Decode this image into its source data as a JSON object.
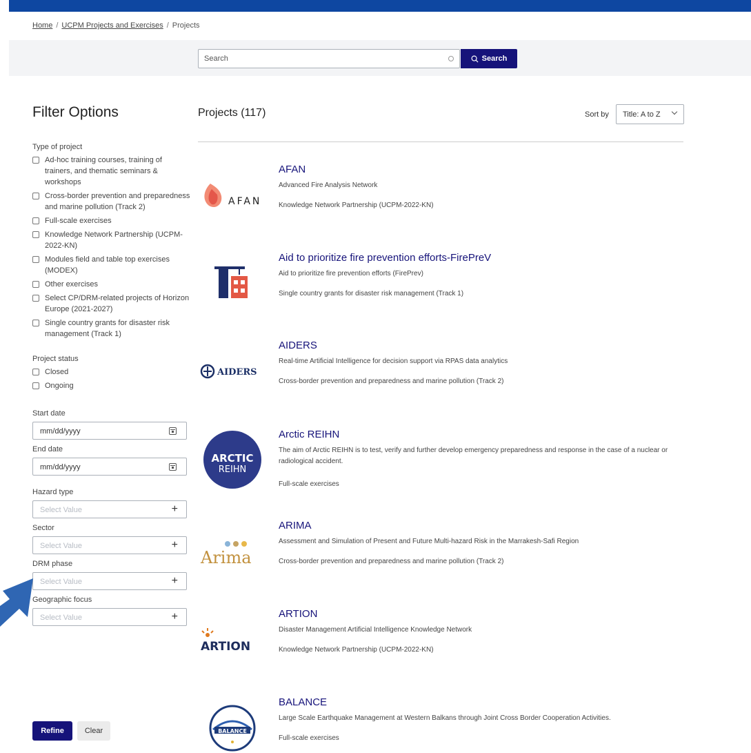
{
  "breadcrumb": {
    "home": "Home",
    "section": "UCPM Projects and Exercises",
    "current": "Projects",
    "separator": "/"
  },
  "search": {
    "placeholder": "Search",
    "button_label": "Search"
  },
  "filters": {
    "title": "Filter Options",
    "type_of_project": {
      "label": "Type of project",
      "options": [
        "Ad-hoc training courses, training of trainers, and thematic seminars & workshops",
        "Cross-border prevention and preparedness and marine pollution (Track 2)",
        "Full-scale exercises",
        "Knowledge Network Partnership (UCPM-2022-KN)",
        "Modules field and table top exercises (MODEX)",
        "Other exercises",
        "Select CP/DRM-related projects of Horizon Europe (2021-2027)",
        "Single country grants for disaster risk management (Track 1)"
      ]
    },
    "project_status": {
      "label": "Project status",
      "options": [
        "Closed",
        "Ongoing"
      ]
    },
    "start_date": {
      "label": "Start date",
      "value": "mm/dd/yyyy"
    },
    "end_date": {
      "label": "End date",
      "value": "mm/dd/yyyy"
    },
    "hazard_type": {
      "label": "Hazard type",
      "placeholder": "Select Value"
    },
    "sector": {
      "label": "Sector",
      "placeholder": "Select Value"
    },
    "drm_phase": {
      "label": "DRM phase",
      "placeholder": "Select Value"
    },
    "geographic_focus": {
      "label": "Geographic focus",
      "placeholder": "Select Value"
    },
    "refine_label": "Refine",
    "clear_label": "Clear"
  },
  "results": {
    "title": "Projects (117)",
    "sort_label": "Sort by",
    "sort_value": "Title: A to Z",
    "projects": [
      {
        "title": "AFAN",
        "description": "Advanced Fire Analysis Network",
        "type": "Knowledge Network Partnership (UCPM-2022-KN)",
        "logo_text": "AFAN"
      },
      {
        "title": "Aid to prioritize fire prevention efforts-FirePreV",
        "description": "Aid to prioritize fire prevention efforts (FirePrev)",
        "type": "Single country grants for disaster risk management (Track 1)",
        "logo_text": ""
      },
      {
        "title": "AIDERS",
        "description": "Real-time Artificial Intelligence for decision support via RPAS data analytics",
        "type": "Cross-border prevention and preparedness and marine pollution (Track 2)",
        "logo_text": "AIDERS"
      },
      {
        "title": "Arctic REIHN",
        "description": "The aim of Arctic REIHN is to test, verify and further develop emergency preparedness and response in the case of a nuclear or radiological accident.",
        "type": "Full-scale exercises",
        "logo_text": "ARCTIC REIHN"
      },
      {
        "title": "ARIMA",
        "description": "Assessment and Simulation of Present and Future Multi-hazard Risk in the Marrakesh-Safi Region",
        "type": "Cross-border prevention and preparedness and marine pollution (Track 2)",
        "logo_text": "Arima"
      },
      {
        "title": "ARTION",
        "description": "Disaster Management Artificial Intelligence Knowledge Network",
        "type": "Knowledge Network Partnership (UCPM-2022-KN)",
        "logo_text": "ARTION"
      },
      {
        "title": "BALANCE",
        "description": "Large Scale Earthquake Management at Western Balkans through Joint Cross Border Cooperation Activities.",
        "type": "Full-scale exercises",
        "logo_text": "BALANCE"
      }
    ]
  },
  "colors": {
    "brand_blue": "#0e47a1",
    "button_navy": "#16137a",
    "title_navy": "#16137a",
    "pointer_blue": "#2f66b3"
  }
}
